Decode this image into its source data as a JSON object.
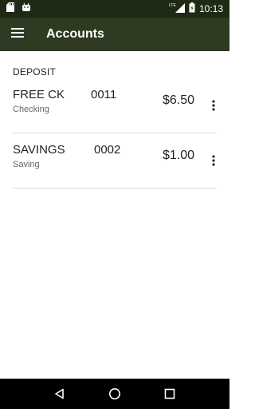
{
  "status_bar": {
    "time": "10:13",
    "network": "LTE",
    "left_icons": [
      "sd-card-icon",
      "android-icon"
    ],
    "right_icons": [
      "lte-signal-icon",
      "battery-icon"
    ]
  },
  "app_bar": {
    "title": "Accounts",
    "menu_icon": "hamburger-menu-icon",
    "background": "#2f3a22"
  },
  "section": {
    "title": "DEPOSIT"
  },
  "accounts": [
    {
      "name": "FREE CK",
      "number": "0011",
      "type": "Checking",
      "balance": "$6.50"
    },
    {
      "name": "SAVINGS",
      "number": "0002",
      "type": "Saving",
      "balance": "$1.00"
    }
  ],
  "nav_bar": {
    "buttons": [
      "back-icon",
      "home-icon",
      "recents-icon"
    ]
  },
  "colors": {
    "status_bar": "#1f2a14",
    "app_bar": "#2f3a22",
    "divider": "#d8d8d8",
    "nav_bar": "#000000"
  }
}
